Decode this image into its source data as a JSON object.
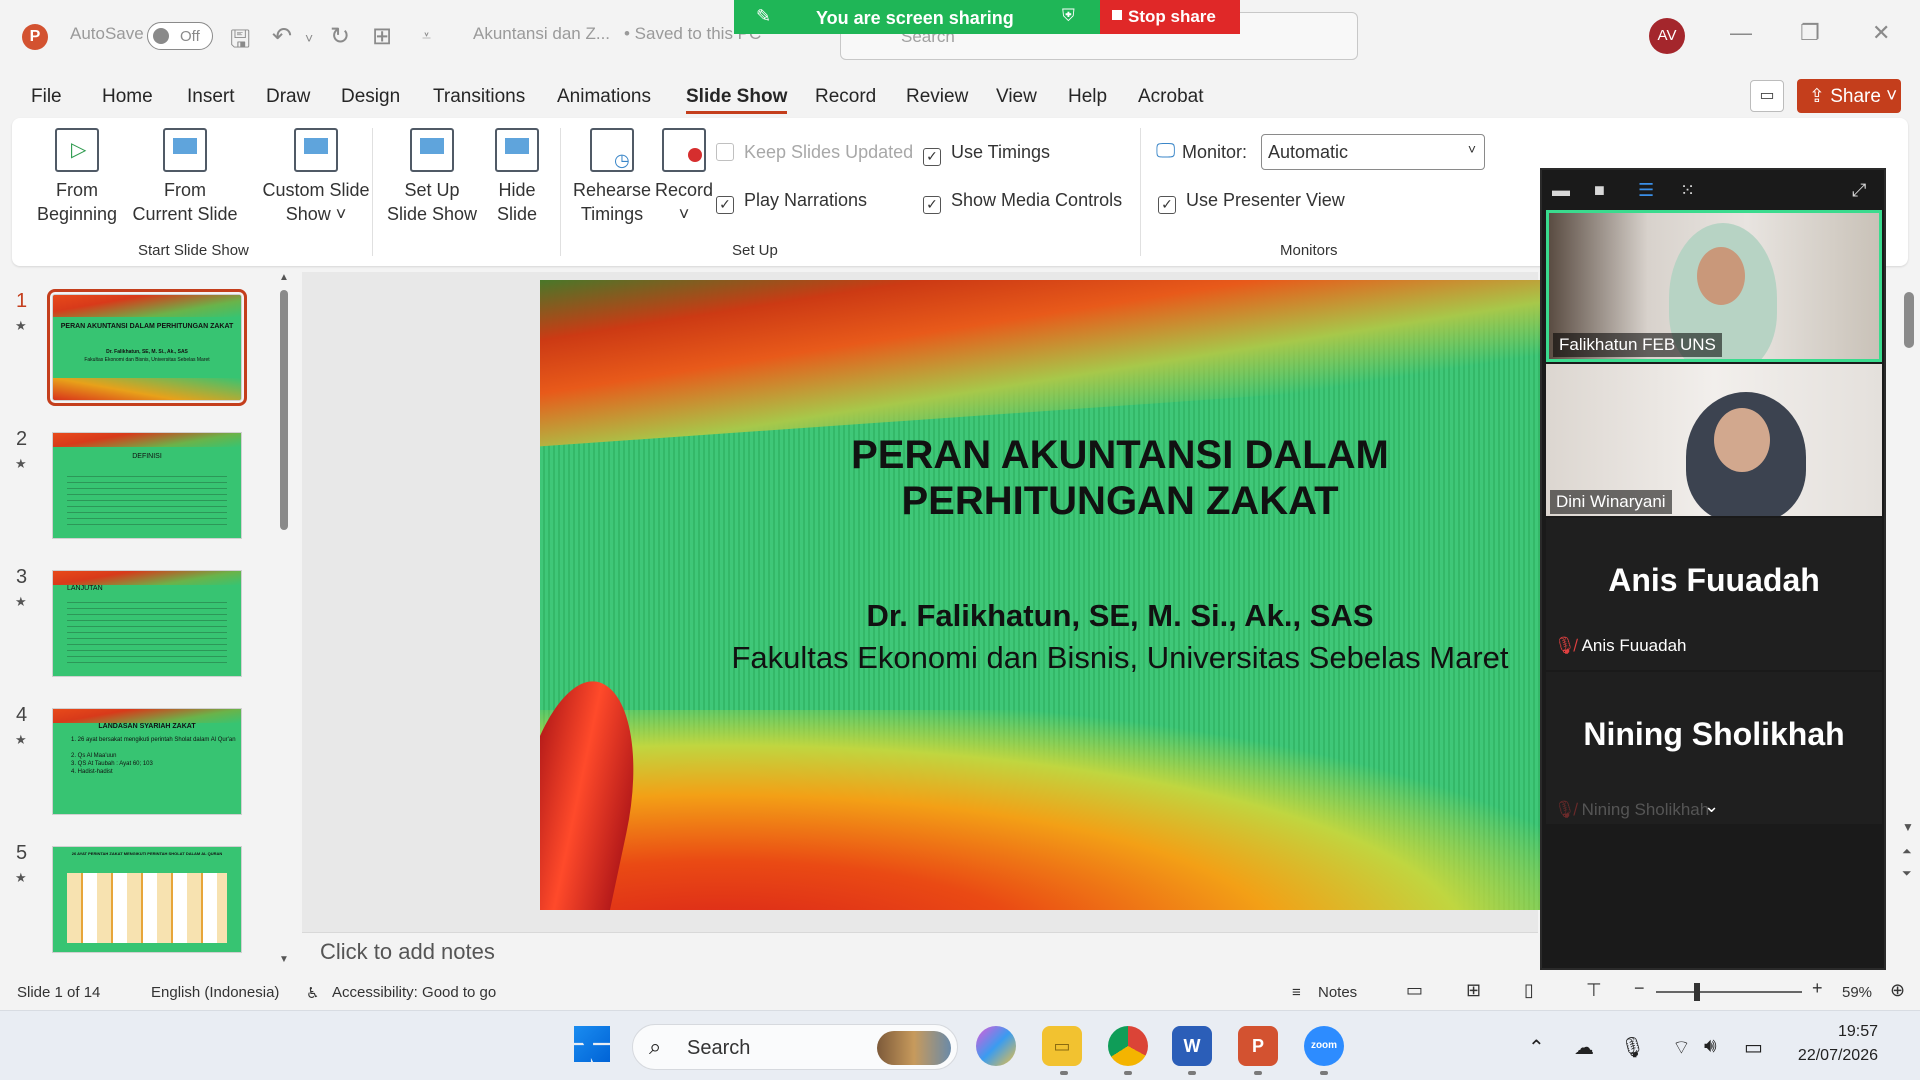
{
  "titlebar": {
    "autosave_label": "AutoSave",
    "autosave_state": "Off",
    "doc_title": "Akuntansi dan Z...",
    "saved_status": "• Saved to this PC",
    "search_placeholder": "Search",
    "avatar_initials": "AV"
  },
  "share_banner": {
    "sharing_text": "You are screen sharing",
    "stop_label": "Stop share"
  },
  "menu": {
    "tabs": [
      "File",
      "Home",
      "Insert",
      "Draw",
      "Design",
      "Transitions",
      "Animations",
      "Slide Show",
      "Record",
      "Review",
      "View",
      "Help",
      "Acrobat"
    ],
    "active_tab": "Slide Show",
    "share_label": "Share"
  },
  "ribbon": {
    "from_beginning": [
      "From",
      "Beginning"
    ],
    "from_current": [
      "From",
      "Current Slide"
    ],
    "custom_show": [
      "Custom Slide",
      "Show ˅"
    ],
    "group_start": "Start Slide Show",
    "set_up": [
      "Set Up",
      "Slide Show"
    ],
    "hide_slide": [
      "Hide",
      "Slide"
    ],
    "rehearse": [
      "Rehearse",
      "Timings"
    ],
    "record": [
      "Record",
      "˅"
    ],
    "keep_updated": "Keep Slides Updated",
    "play_narrations": "Play Narrations",
    "use_timings": "Use Timings",
    "show_media": "Show Media Controls",
    "group_setup": "Set Up",
    "monitor_label": "Monitor:",
    "monitor_value": "Automatic",
    "presenter_view": "Use Presenter View",
    "group_monitors": "Monitors"
  },
  "thumbnails": {
    "numbers": [
      "1",
      "2",
      "3",
      "4",
      "5"
    ],
    "t1_title": "PERAN AKUNTANSI DALAM PERHITUNGAN ZAKAT",
    "t1_author": "Dr. Falikhatun, SE, M. Si., Ak., SAS",
    "t1_affil": "Fakultas Ekonomi dan Bisnis, Universitas Sebelas Maret",
    "t2_title": "DEFINISI",
    "t3_title": "LANJUTAN",
    "t4_title": "LANDASAN SYARIAH  ZAKAT",
    "t4_lines": [
      "1. 26 ayat bersakat mengikuti perintah Sholat dalam  Al Qur'an",
      "2. Qs Al Maa'uun",
      "3. QS  At Taubah :  Ayat 60;  103",
      "4. Hadist-hadist"
    ],
    "t5_title": "26 AYAT PERINTAH ZAKAT MENGIKUTI PERINTAH SHOLAT DALAM AL QURAN"
  },
  "slide": {
    "title_line1": "PERAN AKUNTANSI DALAM",
    "title_line2": "PERHITUNGAN ZAKAT",
    "author": "Dr. Falikhatun, SE, M. Si., Ak., SAS",
    "affiliation": "Fakultas Ekonomi dan Bisnis, Universitas Sebelas Maret"
  },
  "notes_placeholder": "Click to add notes",
  "statusbar": {
    "slide_count": "Slide 1 of 14",
    "language": "English (Indonesia)",
    "accessibility": "Accessibility: Good to go",
    "notes_label": "Notes",
    "zoom": "59%"
  },
  "zoom_panel": {
    "p1": "Falikhatun FEB UNS",
    "p2": "Dini Winaryani",
    "p3_big": "Anis Fuuadah",
    "p3_small": "Anis Fuuadah",
    "p4_big": "Nining Sholikhah",
    "p4_small": "Nining Sholikhah"
  },
  "taskbar": {
    "search_placeholder": "Search",
    "time": "19:57",
    "date": "22/07/2026"
  },
  "colors": {
    "accent": "#c43e1c",
    "share_green": "#1fb657",
    "stop_red": "#e02828",
    "slide_green": "#3fc778"
  }
}
